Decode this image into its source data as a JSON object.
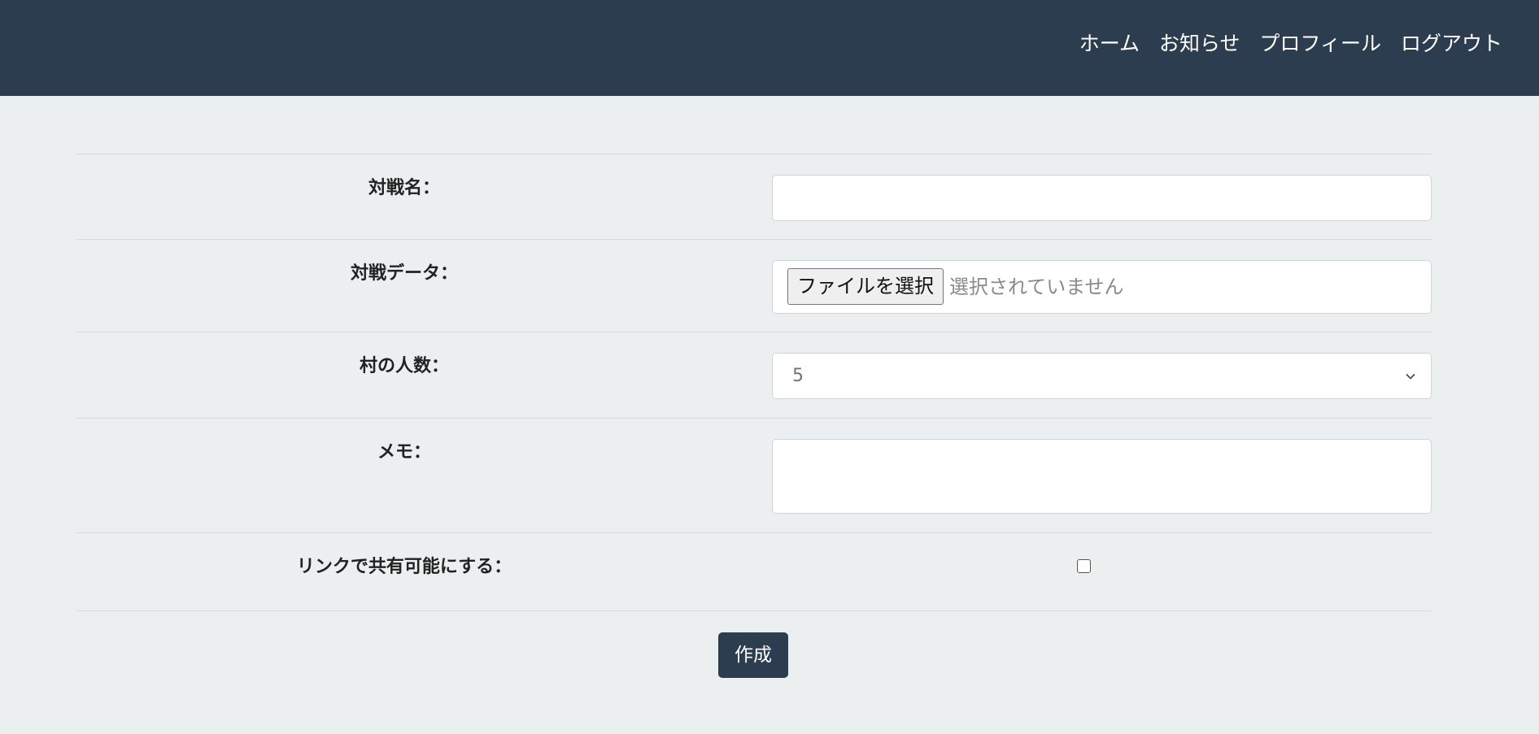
{
  "nav": {
    "items": [
      {
        "label": "ホーム"
      },
      {
        "label": "お知らせ"
      },
      {
        "label": "プロフィール"
      },
      {
        "label": "ログアウト"
      }
    ]
  },
  "form": {
    "battle_name": {
      "label": "対戦名：",
      "value": ""
    },
    "battle_data": {
      "label": "対戦データ：",
      "button_label": "ファイルを選択",
      "status": "選択されていません"
    },
    "village_size": {
      "label": "村の人数：",
      "selected": "5"
    },
    "memo": {
      "label": "メモ：",
      "value": ""
    },
    "share_link": {
      "label": "リンクで共有可能にする：",
      "checked": false
    },
    "submit_label": "作成"
  }
}
